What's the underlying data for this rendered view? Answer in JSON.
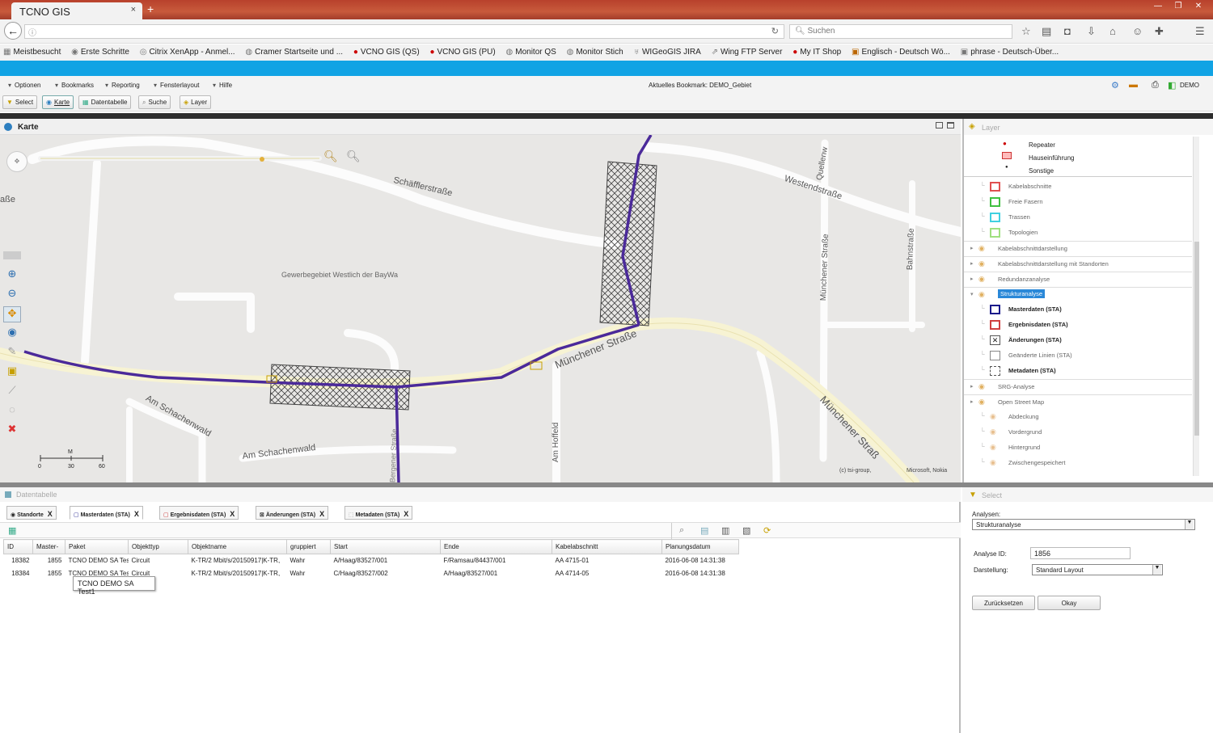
{
  "browser": {
    "tab_title": "TCNO GIS",
    "tab_close": "×",
    "new_tab": "+",
    "search_placeholder": "Suchen",
    "bookmarks": [
      "Meistbesucht",
      "Erste Schritte",
      "Citrix XenApp - Anmel...",
      "Cramer Startseite und ...",
      "VCNO GIS (QS)",
      "VCNO GIS (PU)",
      "Monitor QS",
      "Monitor Stich",
      "WIGeoGIS JIRA",
      "Wing FTP Server",
      "My IT Shop",
      "Englisch - Deutsch Wö...",
      "phrase - Deutsch-Über..."
    ]
  },
  "menubar": {
    "items": [
      "Optionen",
      "Bookmarks",
      "Reporting",
      "Fensterlayout",
      "Hilfe"
    ],
    "current_bookmark": "Aktuelles Bookmark: DEMO_Gebiet",
    "user": "DEMO"
  },
  "toolbar": {
    "buttons": [
      "Select",
      "Karte",
      "Datentabelle",
      "Suche",
      "Layer"
    ]
  },
  "map": {
    "title": "Karte",
    "streets": {
      "schaeffler": "Schäfflerstraße",
      "westend": "Westendstraße",
      "quellen": "Quellenw",
      "muenchener_v": "Münchener Straße",
      "bahn": "Bahnstraße",
      "muenchener_main": "Münchener Straße",
      "muenchener_lower": "Münchener Straß",
      "schachen1": "Am Schachenwald",
      "schachen2": "Am Schachenwald",
      "hoffeld": "Am Hoffeld",
      "left_edge": "aße",
      "bottom_v": "Bergener Straße"
    },
    "area_label": "Gewerbegebiet Westlich der BayWa",
    "scale": {
      "unit": "M",
      "ticks": [
        "0",
        "30",
        "60"
      ]
    },
    "attribution_left": "(c) tsi-group,",
    "attribution_right": "Microsoft, Nokia"
  },
  "layers": {
    "title": "Layer",
    "legend": [
      "Repeater",
      "Hauseinführung",
      "Sonstige"
    ],
    "items": [
      {
        "label": "Kabelabschnitte",
        "level": 1,
        "color": "#e05050",
        "bold": false
      },
      {
        "label": "Freie Fasern",
        "level": 1,
        "color": "#40c040",
        "bold": false
      },
      {
        "label": "Trassen",
        "level": 1,
        "color": "#40d0e0",
        "bold": false
      },
      {
        "label": "Topologien",
        "level": 1,
        "color": "#a0e080",
        "bold": false
      },
      {
        "label": "Kabelabschnittdarstellung",
        "level": 0,
        "bold": false
      },
      {
        "label": "Kabelabschnittdarstellung mit Standorten",
        "level": 0,
        "bold": false
      },
      {
        "label": "Redundanzanalyse",
        "level": 0,
        "bold": false
      },
      {
        "label": "Strukturanalyse",
        "level": 0,
        "bold": false,
        "selected": true
      },
      {
        "label": "Masterdaten (STA)",
        "level": 1,
        "color": "#1a1a8a",
        "bold": true
      },
      {
        "label": "Ergebnisdaten (STA)",
        "level": 1,
        "color": "#d04040",
        "bold": true
      },
      {
        "label": "Änderungen (STA)",
        "level": 1,
        "color": "#555555",
        "bold": true
      },
      {
        "label": "Geänderte Linien (STA)",
        "level": 1,
        "color": "#888888",
        "bold": false
      },
      {
        "label": "Metadaten (STA)",
        "level": 1,
        "color": "#555555",
        "bold": true
      },
      {
        "label": "SRG-Analyse",
        "level": 0,
        "bold": false
      },
      {
        "label": "Open Street Map",
        "level": 0,
        "bold": false
      },
      {
        "label": "Abdeckung",
        "level": 1,
        "bold": false
      },
      {
        "label": "Vordergrund",
        "level": 1,
        "bold": false
      },
      {
        "label": "Hintergrund",
        "level": 1,
        "bold": false
      },
      {
        "label": "Zwischengespeichert",
        "level": 1,
        "bold": false
      }
    ]
  },
  "datatable": {
    "title": "Datentabelle",
    "tabs": [
      "Standorte",
      "Masterdaten (STA)",
      "Ergebnisdaten (STA)",
      "Änderungen (STA)",
      "Metadaten (STA)"
    ],
    "tab_close": "X",
    "columns": [
      "ID",
      "Master-",
      "Paket",
      "Objekttyp",
      "Objektname",
      "gruppiert",
      "Start",
      "Ende",
      "Kabelabschnitt",
      "Planungsdatum"
    ],
    "rows": [
      [
        "18382",
        "1855",
        "TCNO DEMO SA Tes",
        "Circuit",
        "K-TR/2 Mbit/s/20150917|K-TR,",
        "Wahr",
        "A/Haag/83527/001",
        "F/Ramsau/84437/001",
        "AA 4715-01",
        "2016-06-08 14:31:38"
      ],
      [
        "18384",
        "1855",
        "TCNO DEMO SA Tes",
        "Circuit",
        "K-TR/2 Mbit/s/20150917|K-TR,",
        "Wahr",
        "C/Haag/83527/002",
        "A/Haag/83527/001",
        "AA 4714-05",
        "2016-06-08 14:31:38"
      ]
    ],
    "tooltip": "TCNO DEMO SA Test1"
  },
  "select": {
    "title": "Select",
    "analysen_label": "Analysen:",
    "analysen_value": "Strukturanalyse",
    "analyse_id_label": "Analyse ID:",
    "analyse_id_value": "1856",
    "darstellung_label": "Darstellung:",
    "darstellung_value": "Standard Layout",
    "reset": "Zurücksetzen",
    "ok": "Okay"
  }
}
